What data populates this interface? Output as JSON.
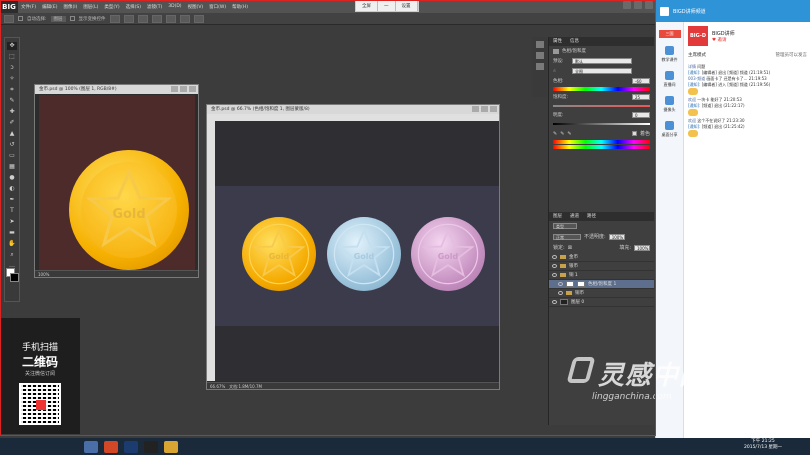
{
  "ps": {
    "logo": "BIG",
    "menu": [
      "文件(F)",
      "编辑(E)",
      "图像(I)",
      "图层(L)",
      "类型(Y)",
      "选择(S)",
      "滤镜(T)",
      "3D(D)",
      "视图(V)",
      "窗口(W)",
      "帮助(H)"
    ],
    "center_tabs": [
      "全屏",
      "一",
      "设置"
    ],
    "options": {
      "auto_select_label": "自动选择:",
      "auto_select_value": "图层",
      "transform_label": "显示变换控件"
    }
  },
  "doc1": {
    "title": "金币.psd @ 100% (图层 1, RGB/8#)",
    "zoom": "100%"
  },
  "doc2": {
    "title": "金币.psd @ 66.7% (色相/饱和度 1, 图层蒙版/8)",
    "zoom": "66.67%",
    "status": "文档:1.8M/10.7M"
  },
  "coins": {
    "label": "Gold"
  },
  "panel": {
    "header_tabs": [
      "属性",
      "信息"
    ],
    "adj_title": "色相/饱和度",
    "preset_label": "预设:",
    "preset_value": "默认",
    "channel_value": "全图",
    "hue_label": "色相:",
    "hue_value": "-60",
    "sat_label": "饱和度:",
    "sat_value": "25",
    "light_label": "明度:",
    "light_value": "0",
    "colorize_label": "着色"
  },
  "layers": {
    "header_tabs": [
      "图层",
      "通道",
      "路径"
    ],
    "kind_label": "类型",
    "blend_label": "正常",
    "opacity_label": "不透明度:",
    "opacity_value": "100%",
    "lock_label": "锁定:",
    "fill_label": "填充:",
    "fill_value": "100%",
    "rows": [
      {
        "name": "金币",
        "type": "folder"
      },
      {
        "name": "银币",
        "type": "folder"
      },
      {
        "name": "铜 1",
        "type": "folder"
      },
      {
        "name": "色相/饱和度 1",
        "type": "adj"
      },
      {
        "name": "铜币",
        "type": "folder"
      },
      {
        "name": "图层 0",
        "type": "layer"
      }
    ]
  },
  "promo": {
    "line1": "手机扫描",
    "line2": "二维码",
    "line3": "关注微信订阅"
  },
  "yy": {
    "top_title": "BIGD讲师频道",
    "nav": [
      {
        "label": "三国"
      },
      {
        "label": "教学课件"
      },
      {
        "label": "直播间"
      },
      {
        "label": "摄像头"
      },
      {
        "label": "桌面分享"
      }
    ],
    "channel_name": "BIGD讲师",
    "subscribe": "♥ 邀请",
    "mode_label": "主席模式",
    "mode_right": "管理员可以发言",
    "chat": [
      {
        "who": "详情",
        "text": "问题"
      },
      {
        "who": "[通知]:",
        "text": "[编辑者] 退出 [频道] 频道 (21:19:51)"
      },
      {
        "who": "003-频道",
        "text": "画面卡了 还是有卡了... 21:19:53"
      },
      {
        "who": "[通知]:",
        "text": "[编辑者] 进入 [频道] 频道 (21:19:56)"
      },
      {
        "who": "欢迎",
        "text": "一块卡 能好了 21:20:53"
      },
      {
        "who": "[通知]:",
        "text": "[频道] 退出 (21:22:17)"
      },
      {
        "who": "欢迎",
        "text": "这个不在说好了 21:23:30"
      },
      {
        "who": "[通知]:",
        "text": "[频道] 退出 (21:25:42)"
      }
    ]
  },
  "taskbar": {
    "time": "下午 21:25",
    "date": "2015/7/13 星期一"
  },
  "watermark": {
    "big": "灵感中国",
    "url": "lingganchina.com"
  }
}
